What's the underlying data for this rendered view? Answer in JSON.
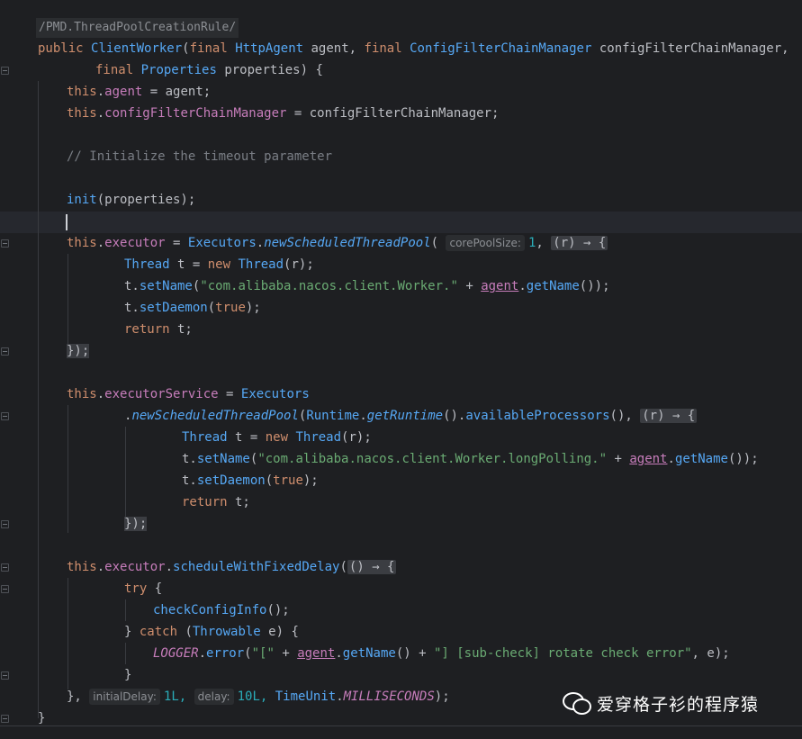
{
  "annotation": "/PMD.ThreadPoolCreationRule/",
  "code": {
    "l1": {
      "kw": "public",
      "name": "ClientWorker",
      "p1kw": "final",
      "p1t": "HttpAgent",
      "p1n": "agent,",
      "p2kw": "final",
      "p2t": "ConfigFilterChainManager",
      "p2n": "configFilterChainManager,"
    },
    "l2": {
      "kw": "final",
      "t": "Properties",
      "n": "properties",
      "end": ") {"
    },
    "l3": {
      "this": "this",
      "fld": "agent",
      "rest": " = agent;"
    },
    "l4": {
      "this": "this",
      "fld": "configFilterChainManager",
      "rest": " = configFilterChainManager;"
    },
    "comment": "// Initialize the timeout parameter",
    "init": {
      "fn": "init",
      "rest": "(properties);"
    },
    "exec": {
      "this": "this",
      "fld": "executor",
      "eq": " = ",
      "cls": "Executors",
      "mth": "newScheduledThreadPool",
      "hint": "corePoolSize:",
      "num": "1",
      "lam": "(r) → {"
    },
    "t1": {
      "cls": "Thread",
      "t": " t = ",
      "kw": "new",
      "cls2": "Thread",
      "arg": "(r);"
    },
    "t2": {
      "pre": "t.",
      "mth": "setName",
      "str": "\"com.alibaba.nacos.client.Worker.\"",
      "plus": " + ",
      "fld": "agent",
      "mth2": "getName",
      "end": "());"
    },
    "t3": {
      "pre": "t.",
      "mth": "setDaemon",
      "kw": "true",
      "end": ");"
    },
    "t4": {
      "kw": "return",
      "rest": " t;"
    },
    "close1": "});",
    "svc": {
      "this": "this",
      "fld": "executorService",
      "eq": " = ",
      "cls": "Executors"
    },
    "svc2": {
      "mth": "newScheduledThreadPool",
      "cls": "Runtime",
      "mth2": "getRuntime",
      "mth3": "availableProcessors",
      "lam": "(r) → {"
    },
    "u1": {
      "cls": "Thread",
      "t": " t = ",
      "kw": "new",
      "cls2": "Thread",
      "arg": "(r);"
    },
    "u2": {
      "pre": "t.",
      "mth": "setName",
      "str": "\"com.alibaba.nacos.client.Worker.longPolling.\"",
      "plus": " + ",
      "fld": "agent",
      "mth2": "getName",
      "end": "());"
    },
    "u3": {
      "pre": "t.",
      "mth": "setDaemon",
      "kw": "true",
      "end": ");"
    },
    "u4": {
      "kw": "return",
      "rest": " t;"
    },
    "close2": "});",
    "sched": {
      "this": "this",
      "fld": "executor",
      "mth": "scheduleWithFixedDelay",
      "lam": "() → {"
    },
    "try": {
      "kw": "try",
      "rest": " {"
    },
    "check": {
      "fn": "checkConfigInfo",
      "rest": "();"
    },
    "catch": {
      "pre": "} ",
      "kw": "catch",
      "cls": "Throwable",
      "rest": " e) {"
    },
    "log": {
      "cnst": "LOGGER",
      "mth": "error",
      "str1": "\"[\"",
      "fld": "agent",
      "mth2": "getName",
      "str2": "\"] [sub-check] rotate check error\"",
      "rest": ", e);"
    },
    "close3": "}",
    "final": {
      "pre": "}, ",
      "hint1": "initialDelay:",
      "n1": "1L,",
      "hint2": "delay:",
      "n2": "10L,",
      "cls": "TimeUnit",
      "cnst": "MILLISECONDS",
      "end": ");"
    },
    "last": "}"
  },
  "watermark": "爱穿格子衫的程序猿"
}
